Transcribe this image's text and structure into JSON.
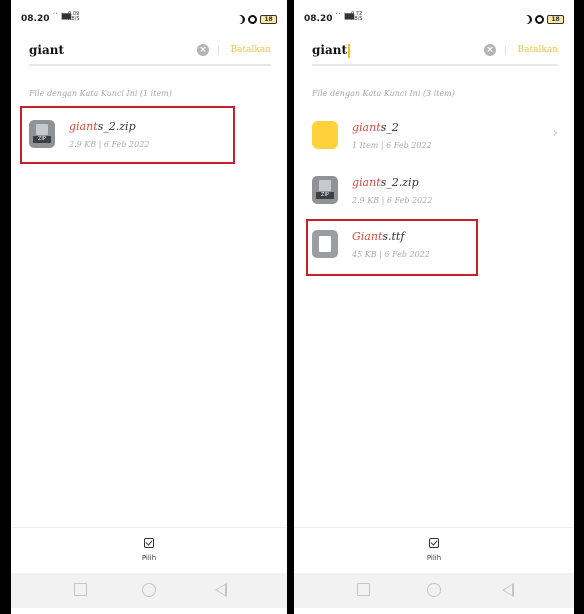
{
  "colors": {
    "highlight": "#e0463d",
    "accent": "#e8c24a",
    "annotation": "#c8202a",
    "folder": "#ffd23c"
  },
  "left": {
    "status": {
      "time": "08.20",
      "net": "´´▕▇▇",
      "speed": "0,09 KB/S",
      "battery": "18"
    },
    "search": {
      "query": "giant",
      "cancel_label": "Batalkan"
    },
    "results_header": "File dengan Kata Kunci Ini (1 item)",
    "items": [
      {
        "icon": "zip-file-icon",
        "name_hl": "giant",
        "name_rest": "s_2.zip",
        "meta": "2.9 KB | 6 Feb 2022"
      }
    ],
    "bottom": {
      "select_label": "Pilih"
    }
  },
  "right": {
    "status": {
      "time": "08.20",
      "net": "´´▕▇▇",
      "speed": "0,72 KB/S",
      "battery": "18"
    },
    "search": {
      "query": "giant",
      "cancel_label": "Batalkan"
    },
    "results_header": "File dengan Kata Kunci Ini (3 item)",
    "items": [
      {
        "icon": "folder-icon",
        "name_hl": "giant",
        "name_rest": "s_2",
        "meta": "1 Item | 6 Feb 2022"
      },
      {
        "icon": "zip-file-icon",
        "name_hl": "giant",
        "name_rest": "s_2.zip",
        "meta": "2.9 KB | 6 Feb 2022"
      },
      {
        "icon": "font-file-icon",
        "name_hl": "Giant",
        "name_rest": "s.ttf",
        "meta": "45 KB | 6 Feb 2022"
      }
    ],
    "bottom": {
      "select_label": "Pilih"
    }
  }
}
